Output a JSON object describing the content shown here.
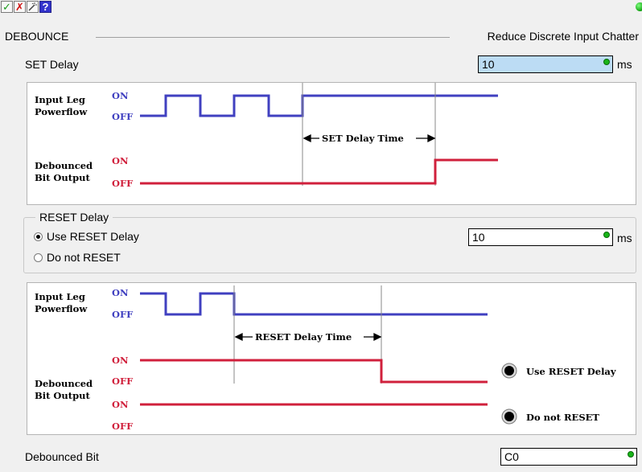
{
  "toolbar": {
    "accept_icon": "check-icon",
    "cancel_icon": "x-icon",
    "tool_icon": "wand-icon",
    "help_label": "?"
  },
  "header": {
    "section_label": "DEBOUNCE",
    "description": "Reduce Discrete Input Chatter"
  },
  "set_delay": {
    "label": "SET Delay",
    "value": "10",
    "unit": "ms"
  },
  "set_diagram": {
    "input_label_line1": "Input Leg",
    "input_label_line2": "Powerflow",
    "on": "ON",
    "off": "OFF",
    "output_label_line1": "Debounced",
    "output_label_line2": "Bit Output",
    "delay_label": "SET Delay Time"
  },
  "reset_delay": {
    "group_label": "RESET Delay",
    "option_use": "Use RESET Delay",
    "option_none": "Do not RESET",
    "selected": "Use RESET Delay",
    "value": "10",
    "unit": "ms"
  },
  "reset_diagram": {
    "input_label_line1": "Input Leg",
    "input_label_line2": "Powerflow",
    "on": "ON",
    "off": "OFF",
    "output_label_line1": "Debounced",
    "output_label_line2": "Bit Output",
    "delay_label": "RESET Delay Time",
    "legend_use": "Use RESET Delay",
    "legend_none": "Do not RESET"
  },
  "debounced_bit": {
    "label": "Debounced Bit",
    "value": "C0"
  },
  "colors": {
    "input_trace": "#4040c0",
    "output_trace": "#d0203c",
    "input_field_highlight": "#bcdcf4"
  }
}
